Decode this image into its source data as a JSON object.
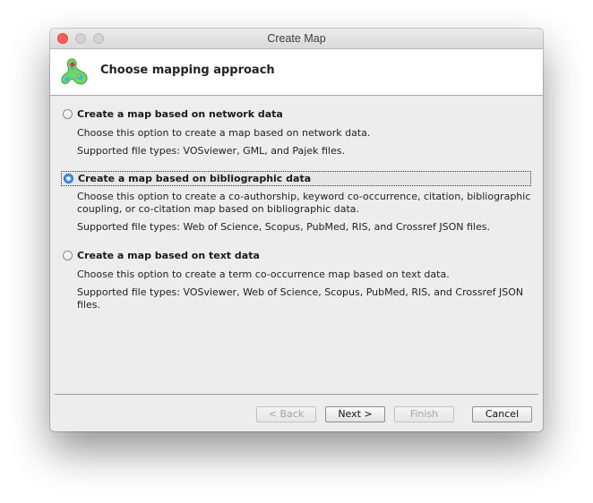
{
  "window": {
    "title": "Create Map"
  },
  "header": {
    "title": "Choose mapping approach",
    "logo_icon": "vosviewer-logo-icon"
  },
  "options": [
    {
      "label": "Create a map based on network data",
      "selected": false,
      "description": "Choose this option to create a map based on network data.",
      "file_types": "Supported file types: VOSviewer, GML, and Pajek files."
    },
    {
      "label": "Create a map based on bibliographic data",
      "selected": true,
      "description": "Choose this option to create a co-authorship, keyword co-occurrence, citation, bibliographic coupling, or co-citation map based on bibliographic data.",
      "file_types": "Supported file types: Web of Science, Scopus, PubMed, RIS, and Crossref JSON files."
    },
    {
      "label": "Create a map based on text data",
      "selected": false,
      "description": "Choose this option to create a term co-occurrence map based on text data.",
      "file_types": "Supported file types: VOSviewer, Web of Science, Scopus, PubMed, RIS, and Crossref JSON files."
    }
  ],
  "buttons": {
    "back": "< Back",
    "next": "Next >",
    "finish": "Finish",
    "cancel": "Cancel"
  },
  "colors": {
    "close": "#fc5f57",
    "radio_selected": "#2c6fc2",
    "logo_green": "#6fd66a"
  }
}
